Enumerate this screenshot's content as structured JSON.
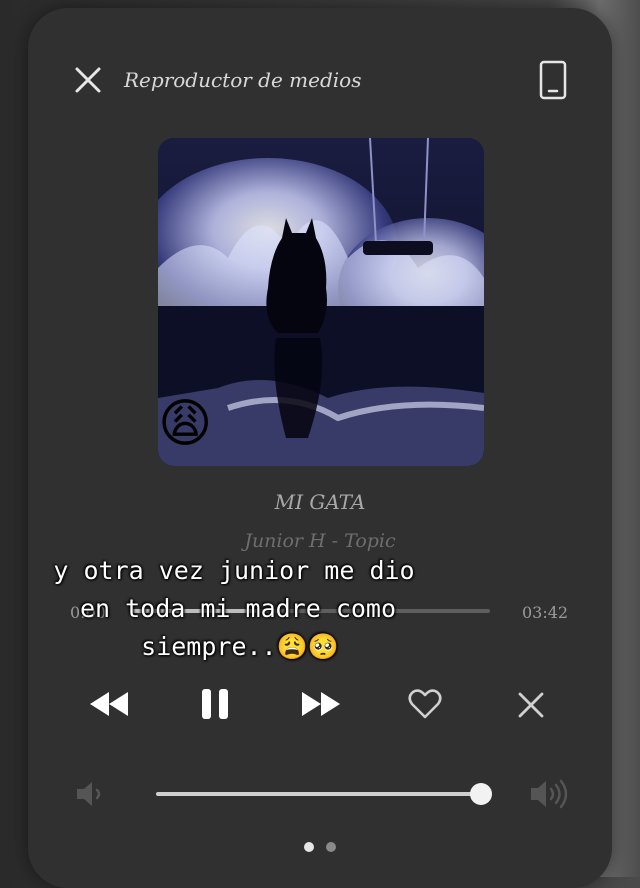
{
  "header": {
    "title": "Reproductor de medios",
    "close_icon": "close-icon",
    "device_icon": "phone-device-icon"
  },
  "track": {
    "name": "MI GATA",
    "artist": "Junior H - Topic",
    "artwork_sticker": "😩"
  },
  "progress": {
    "current": "0:00",
    "total": "03:42",
    "fraction": 0.35
  },
  "overlay_caption": {
    "line1": "y otra vez junior me dio",
    "line2": "en toda mi madre como",
    "line3": "siempre..😩🥺"
  },
  "controls": {
    "rewind_icon": "rewind-icon",
    "pause_icon": "pause-icon",
    "fast_forward_icon": "fast-forward-icon",
    "like_icon": "heart-icon",
    "dismiss_icon": "close-icon"
  },
  "volume": {
    "low_icon": "volume-low-icon",
    "high_icon": "volume-high-icon",
    "level": 0.98
  },
  "pager": {
    "pages": 2,
    "active": 1
  }
}
